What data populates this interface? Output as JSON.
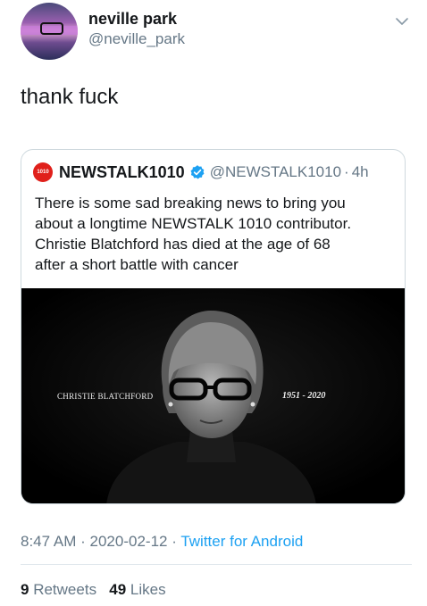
{
  "author": {
    "name": "neville park",
    "handle": "@neville_park"
  },
  "tweet": {
    "text": "thank fuck"
  },
  "quoted": {
    "logo_text": "1010",
    "name": "NEWSTALK1010",
    "handle": "@NEWSTALK1010",
    "separator": "·",
    "time": "4h",
    "text_lines": [
      "There is some sad breaking news to bring you",
      "about a longtime NEWSTALK 1010 contributor.",
      "Christie Blatchford has died at the age of 68",
      "after a short battle with cancer"
    ],
    "image": {
      "caption_name": "CHRISTIE BLATCHFORD",
      "caption_years": "1951 - 2020"
    }
  },
  "meta": {
    "time": "8:47 AM",
    "separator": "·",
    "date": "2020-02-12",
    "source": "Twitter for Android"
  },
  "stats": {
    "retweets_count": "9",
    "retweets_label": "Retweets",
    "likes_count": "49",
    "likes_label": "Likes"
  },
  "icons": {
    "chevron": "chevron-down-icon",
    "verified": "verified-badge-icon"
  },
  "colors": {
    "link": "#1da1f2",
    "secondary_text": "#657786",
    "brand_red": "#e0201b"
  }
}
